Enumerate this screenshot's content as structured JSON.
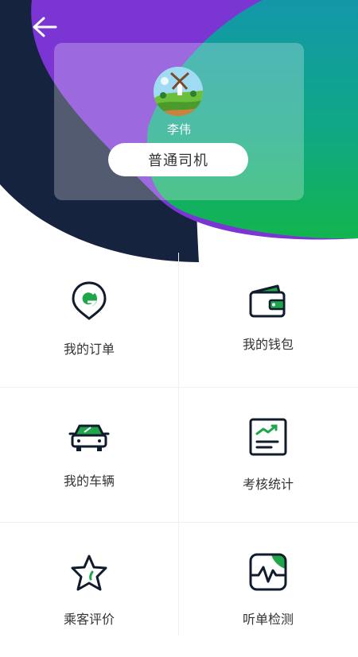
{
  "header": {
    "back_icon": "arrow-left-icon",
    "colors": {
      "dark": "#16233f",
      "purple": "#7a35d3",
      "teal": "#0e9ea4",
      "green": "#13b455"
    }
  },
  "profile": {
    "name": "李伟",
    "role": "普通司机",
    "avatar_icon": "windmill-landscape-avatar"
  },
  "menu": {
    "items": [
      {
        "label": "我的订单",
        "icon": "location-pin-order-icon"
      },
      {
        "label": "我的钱包",
        "icon": "wallet-icon"
      },
      {
        "label": "我的车辆",
        "icon": "car-icon"
      },
      {
        "label": "考核统计",
        "icon": "statistics-chart-icon"
      },
      {
        "label": "乘客评价",
        "icon": "star-icon"
      },
      {
        "label": "听单检测",
        "icon": "pulse-monitor-icon"
      }
    ],
    "accent": "#1fa64a",
    "outline": "#101c2c"
  }
}
